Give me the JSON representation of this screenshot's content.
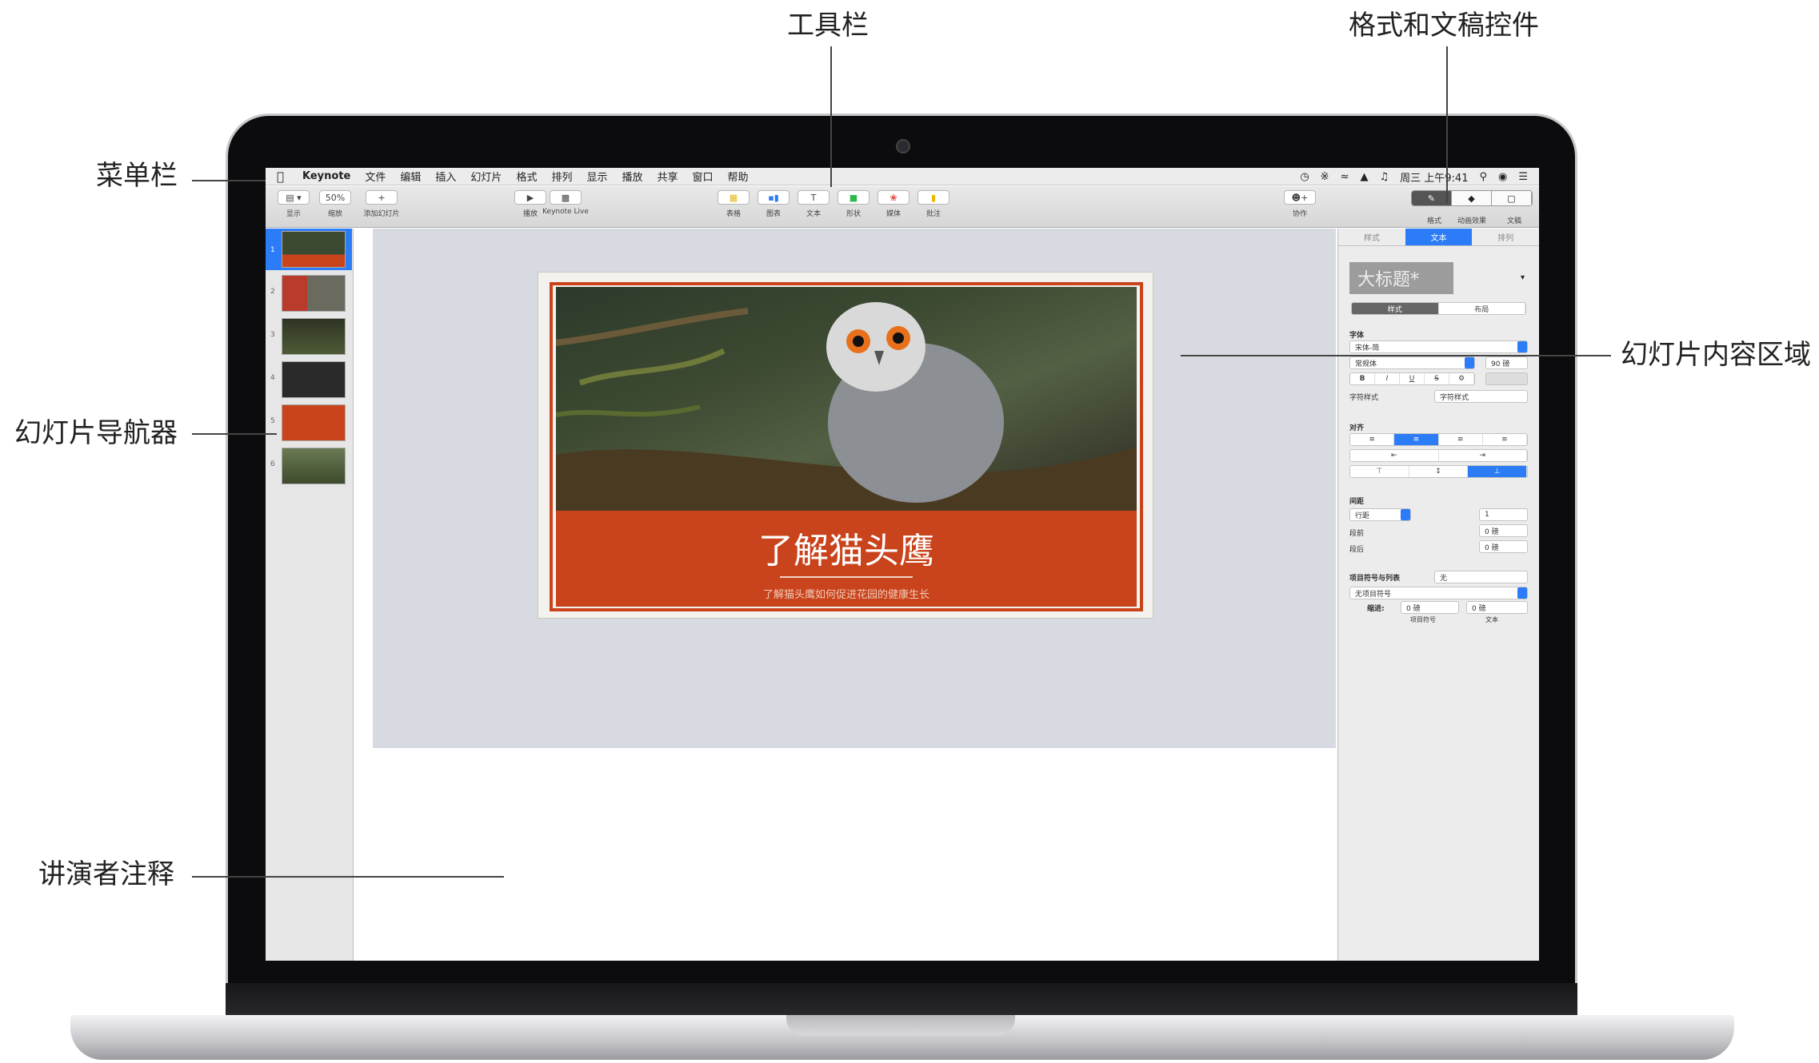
{
  "callouts": {
    "toolbar": "工具栏",
    "format_controls": "格式和文稿控件",
    "menubar": "菜单栏",
    "slide_canvas": "幻灯片内容区域",
    "navigator": "幻灯片导航器",
    "presenter_notes": "讲演者注释"
  },
  "menubar": {
    "apple": "",
    "app": "Keynote",
    "items": [
      "文件",
      "编辑",
      "插入",
      "幻灯片",
      "格式",
      "排列",
      "显示",
      "播放",
      "共享",
      "窗口",
      "帮助"
    ],
    "clock": "周三 上午9:41"
  },
  "toolbar": {
    "view": "显示",
    "zoom_value": "50%",
    "zoom": "缩放",
    "add_slide": "添加幻灯片",
    "play": "播放",
    "keynote_live": "Keynote Live",
    "table": "表格",
    "chart": "图表",
    "text": "文本",
    "shape": "形状",
    "media": "媒体",
    "comment": "批注",
    "collaborate": "协作",
    "format": "格式",
    "animate": "动画效果",
    "document": "文稿"
  },
  "navigator": {
    "numbers": [
      "1",
      "2",
      "3",
      "4",
      "5",
      "6"
    ]
  },
  "slide": {
    "title": "了解猫头鹰",
    "subtitle": "了解猫头鹰如何促进花园的健康生长"
  },
  "inspector": {
    "tabs": [
      "样式",
      "文本",
      "排列"
    ],
    "active_tab": "文本",
    "paragraph_style": "大标题*",
    "style_tabs": [
      "样式",
      "布局"
    ],
    "font_label": "字体",
    "font_family": "宋体-简",
    "font_weight": "常规体",
    "font_size": "90 磅",
    "char_style_label": "字符样式",
    "char_style": "字符样式",
    "alignment_label": "对齐",
    "spacing_label": "间距",
    "spacing_mode": "行距",
    "spacing_value": "1",
    "before_label": "段前",
    "before_value": "0 磅",
    "after_label": "段后",
    "after_value": "0 磅",
    "bullets_label": "项目符号与列表",
    "bullets_value": "无",
    "bullet_type": "无项目符号",
    "indent_label": "缩进:",
    "indent_bullet": "0 磅",
    "indent_bullet_caption": "项目符号",
    "indent_text": "0 磅",
    "indent_text_caption": "文本"
  },
  "colors": {
    "accent": "#2b7cf6",
    "slide_band": "#c9441c"
  }
}
